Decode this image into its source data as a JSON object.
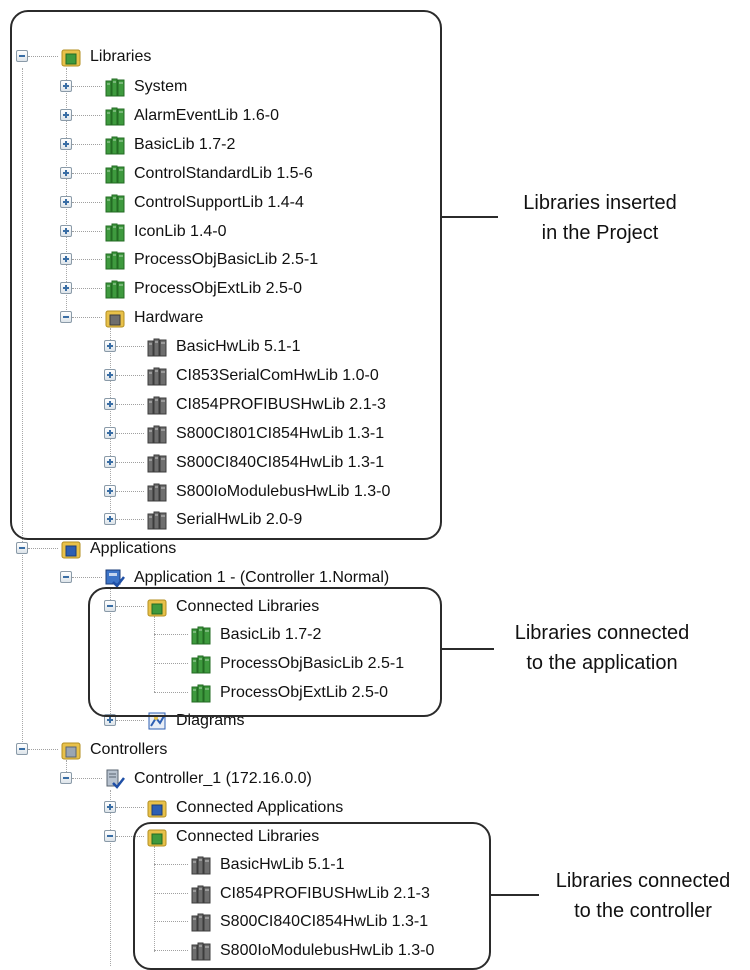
{
  "tree": {
    "libraries": {
      "label": "Libraries",
      "icon": "library-folder-icon",
      "items": [
        {
          "label": "System",
          "icon": "green-library-icon"
        },
        {
          "label": "AlarmEventLib 1.6-0",
          "icon": "green-library-icon"
        },
        {
          "label": "BasicLib 1.7-2",
          "icon": "green-library-icon"
        },
        {
          "label": "ControlStandardLib 1.5-6",
          "icon": "green-library-icon"
        },
        {
          "label": "ControlSupportLib 1.4-4",
          "icon": "green-library-icon"
        },
        {
          "label": "IconLib 1.4-0",
          "icon": "green-library-icon"
        },
        {
          "label": "ProcessObjBasicLib 2.5-1",
          "icon": "green-library-icon"
        },
        {
          "label": "ProcessObjExtLib 2.5-0",
          "icon": "green-library-icon"
        }
      ],
      "hardware": {
        "label": "Hardware",
        "icon": "hardware-folder-icon",
        "items": [
          {
            "label": "BasicHwLib 5.1-1",
            "icon": "gray-hw-library-icon"
          },
          {
            "label": "CI853SerialComHwLib 1.0-0",
            "icon": "gray-hw-library-icon"
          },
          {
            "label": "CI854PROFIBUSHwLib 2.1-3",
            "icon": "gray-hw-library-icon"
          },
          {
            "label": "S800CI801CI854HwLib 1.3-1",
            "icon": "gray-hw-library-icon"
          },
          {
            "label": "S800CI840CI854HwLib 1.3-1",
            "icon": "gray-hw-library-icon"
          },
          {
            "label": "S800IoModulebusHwLib 1.3-0",
            "icon": "gray-hw-library-icon"
          },
          {
            "label": "SerialHwLib 2.0-9",
            "icon": "gray-hw-library-icon"
          }
        ]
      }
    },
    "applications": {
      "label": "Applications",
      "icon": "applications-folder-icon",
      "application": {
        "label": "Application 1 - (Controller 1.Normal)",
        "icon": "application-icon",
        "connected_libraries": {
          "label": "Connected Libraries",
          "icon": "connected-libraries-folder-icon",
          "items": [
            {
              "label": "BasicLib 1.7-2"
            },
            {
              "label": "ProcessObjBasicLib 2.5-1"
            },
            {
              "label": "ProcessObjExtLib 2.5-0"
            }
          ]
        },
        "diagrams": {
          "label": "Diagrams",
          "icon": "diagrams-icon"
        }
      }
    },
    "controllers": {
      "label": "Controllers",
      "icon": "controllers-folder-icon",
      "controller": {
        "label": "Controller_1 (172.16.0.0)",
        "icon": "controller-icon",
        "connected_applications": {
          "label": "Connected Applications",
          "icon": "connected-applications-icon"
        },
        "connected_libraries": {
          "label": "Connected Libraries",
          "icon": "connected-libraries-folder-icon",
          "items": [
            {
              "label": "BasicHwLib 5.1-1"
            },
            {
              "label": "CI854PROFIBUSHwLib 2.1-3"
            },
            {
              "label": "S800CI840CI854HwLib 1.3-1"
            },
            {
              "label": "S800IoModulebusHwLib 1.3-0"
            }
          ]
        }
      }
    }
  },
  "annotations": {
    "project_libraries": {
      "line1": "Libraries inserted",
      "line2": "in the Project"
    },
    "application_libraries": {
      "line1": "Libraries connected",
      "line2": "to the application"
    },
    "controller_libraries": {
      "line1": "Libraries connected",
      "line2": "to the controller"
    }
  },
  "colors": {
    "library_green": "#3e9a3e",
    "hw_gray": "#6e6e6e",
    "folder_yellow": "#e8c14a",
    "callout_border": "#2b2b2b"
  }
}
